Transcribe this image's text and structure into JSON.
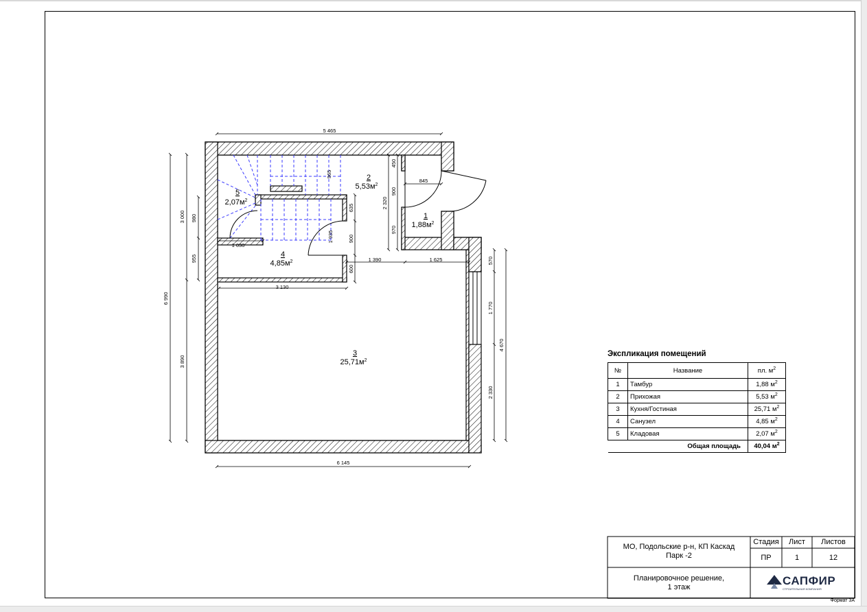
{
  "plan": {
    "rooms": [
      {
        "num": "1",
        "area": "1,88м",
        "sup": "2"
      },
      {
        "num": "2",
        "area": "5,53м",
        "sup": "2"
      },
      {
        "num": "3",
        "area": "25,71м",
        "sup": "2"
      },
      {
        "num": "4",
        "area": "4,85м",
        "sup": "2"
      },
      {
        "num": "5",
        "area": "2,07м",
        "sup": "2"
      }
    ],
    "dimensions": {
      "top_total": "5 465",
      "bottom_total": "6 145",
      "left_total": "6 990",
      "left_upper": "3 000",
      "left_lower": "3 890",
      "left_980": "980",
      "left_955": "955",
      "d_1030": "1 030",
      "d_3130": "3 130",
      "d_1390": "1 390",
      "d_1625": "1 625",
      "d_845": "845",
      "d_965": "965",
      "d_635": "635",
      "d_900a": "900",
      "d_1935": "1 935",
      "d_600": "600",
      "d_450": "450",
      "d_900b": "900",
      "d_970": "970",
      "d_2320": "2 320",
      "right_570": "570",
      "right_1770": "1 770",
      "right_2330": "2 330",
      "right_4670": "4 670"
    }
  },
  "explication": {
    "title": "Экспликация помещений",
    "headers": {
      "num": "№",
      "name": "Название",
      "area": "пл. м",
      "area_sup": "2"
    },
    "rows": [
      {
        "num": "1",
        "name": "Тамбур",
        "area": "1,88 м",
        "sup": "2"
      },
      {
        "num": "2",
        "name": "Прихожая",
        "area": "5,53 м",
        "sup": "2"
      },
      {
        "num": "3",
        "name": "Кухня/Гостиная",
        "area": "25,71 м",
        "sup": "2"
      },
      {
        "num": "4",
        "name": "Санузел",
        "area": "4,85 м",
        "sup": "2"
      },
      {
        "num": "5",
        "name": "Кладовая",
        "area": "2,07 м",
        "sup": "2"
      }
    ],
    "total_label": "Общая площадь",
    "total_value": "40,04 м",
    "total_sup": "2"
  },
  "title_block": {
    "address_line1": "МО, Подольские р-н, КП Каскад",
    "address_line2": "Парк -2",
    "sheet_title_line1": "Планировочное решение,",
    "sheet_title_line2": "1 этаж",
    "stage_label": "Стадия",
    "sheet_label": "Лист",
    "sheets_label": "Листов",
    "stage_value": "ПР",
    "sheet_value": "1",
    "sheets_value": "12",
    "logo_text": "САПФИР",
    "logo_subtext": "СТРОИТЕЛЬНАЯ КОМПАНИЯ",
    "format": "Формат 3А"
  }
}
